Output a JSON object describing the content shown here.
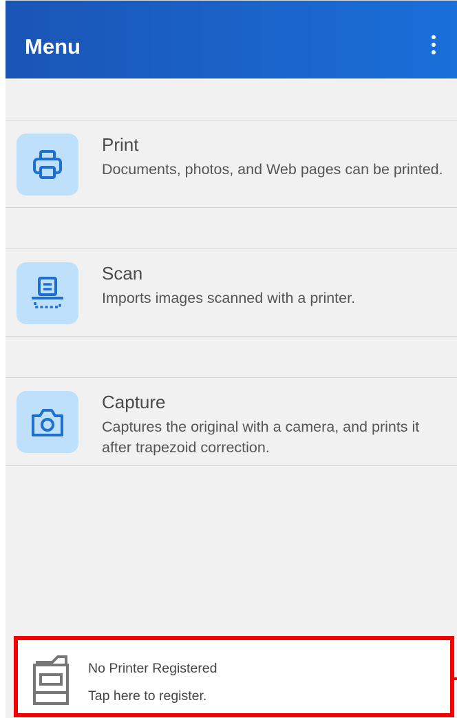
{
  "app_bar": {
    "title": "Menu",
    "overflow_icon": "more-vertical-icon"
  },
  "menu_items": [
    {
      "title": "Print",
      "description": "Documents, photos, and Web pages can be printed.",
      "icon": "printer-icon"
    },
    {
      "title": "Scan",
      "description": "Imports images scanned with a printer.",
      "icon": "scanner-icon"
    },
    {
      "title": "Capture",
      "description": "Captures the original with a camera, and prints it after trapezoid correction.",
      "icon": "camera-icon"
    }
  ],
  "printer_status": {
    "name": "No Printer Registered",
    "hint": "Tap here to register.",
    "icon": "multifunction-printer-icon"
  },
  "colors": {
    "app_bar": "#1a62c8",
    "icon_background": "#bfe0fb",
    "icon_stroke": "#1f6fd1",
    "highlight_frame": "#f20000"
  }
}
